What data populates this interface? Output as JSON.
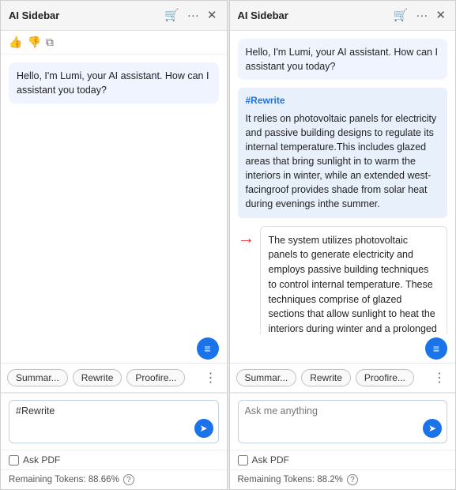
{
  "left_panel": {
    "title": "AI Sidebar",
    "greeting": "Hello, I'm Lumi, your AI assistant. How can I assistant you today?",
    "quick_actions": [
      "Summar...",
      "Rewrite",
      "Proofire..."
    ],
    "more_label": "⋯",
    "input_value": "#Rewrite",
    "input_placeholder": "",
    "askpdf_label": "Ask PDF",
    "tokens_label": "Remaining Tokens: 88.66%"
  },
  "right_panel": {
    "title": "AI Sidebar",
    "greeting": "Hello, I'm Lumi, your AI assistant. How can I assistant you today?",
    "rewrite_tag": "#Rewrite",
    "rewrite_text": "It relies on photovoltaic panels for electricity and passive building designs to regulate its internal temperature.This includes glazed areas that bring sunlight in to warm the interiors in winter, while an extended west-facingroof provides shade from solar heat during evenings inthe summer.",
    "result_text": "The system utilizes photovoltaic panels to generate electricity and employs passive building techniques to control internal temperature. These techniques comprise of glazed sections that allow sunlight to heat the interiors during winter and a prolonged west-facing roof that offers shade from solar heat in the summer evenings.",
    "quick_actions": [
      "Summar...",
      "Rewrite",
      "Proofire..."
    ],
    "more_label": "⋯",
    "input_placeholder": "Ask me anything",
    "askpdf_label": "Ask PDF",
    "tokens_label": "Remaining Tokens: 88.2%"
  },
  "icons": {
    "cart": "🛒",
    "thumbs_up": "👍",
    "thumbs_down": "👎",
    "copy": "⧉",
    "close": "✕",
    "more": "···",
    "doc": "≡",
    "send": "➤",
    "help": "?",
    "arrow": "→"
  }
}
